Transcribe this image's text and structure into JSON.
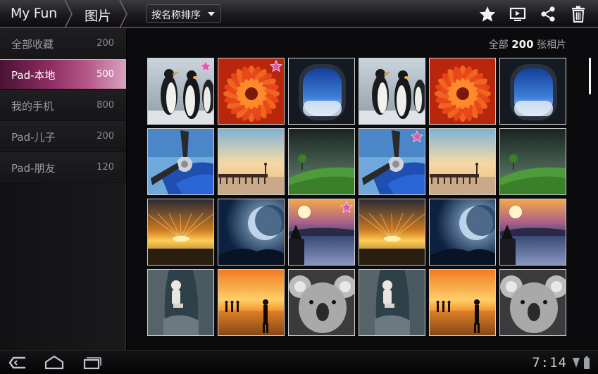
{
  "header": {
    "app_title": "My Fun",
    "page_title": "图片",
    "sort_label": "按名称排序",
    "accent_color": "#a0306a"
  },
  "toolbar": {
    "icons": [
      "star-icon",
      "slideshow-icon",
      "share-icon",
      "trash-icon"
    ]
  },
  "sidebar": {
    "items": [
      {
        "label": "全部收藏",
        "count": "200",
        "active": false
      },
      {
        "label": "Pad-本地",
        "count": "500",
        "active": true
      },
      {
        "label": "我的手机",
        "count": "800",
        "active": false
      },
      {
        "label": "Pad-儿子",
        "count": "200",
        "active": false
      },
      {
        "label": "Pad-朋友",
        "count": "120",
        "active": false
      }
    ]
  },
  "main": {
    "total_prefix": "全部",
    "total_count": "200",
    "total_suffix": "张相片",
    "photos": [
      {
        "subject": "penguins",
        "starred": true
      },
      {
        "subject": "red-flower",
        "starred": true
      },
      {
        "subject": "airplane-window",
        "starred": false
      },
      {
        "subject": "penguins",
        "starred": false
      },
      {
        "subject": "red-flower",
        "starred": false
      },
      {
        "subject": "airplane-window",
        "starred": false
      },
      {
        "subject": "propeller",
        "starred": false
      },
      {
        "subject": "pier-sunset",
        "starred": false
      },
      {
        "subject": "green-hill",
        "starred": false
      },
      {
        "subject": "propeller",
        "starred": true
      },
      {
        "subject": "pier-sunset",
        "starred": false
      },
      {
        "subject": "green-hill",
        "starred": false
      },
      {
        "subject": "sunset-sea",
        "starred": false
      },
      {
        "subject": "moon-night",
        "starred": false
      },
      {
        "subject": "sunrise-lake",
        "starred": true
      },
      {
        "subject": "sunset-sea",
        "starred": false
      },
      {
        "subject": "moon-night",
        "starred": false
      },
      {
        "subject": "sunrise-lake",
        "starred": false
      },
      {
        "subject": "girl-tree",
        "starred": false
      },
      {
        "subject": "beach-silhouettes",
        "starred": false
      },
      {
        "subject": "koala",
        "starred": false
      },
      {
        "subject": "girl-tree",
        "starred": false
      },
      {
        "subject": "beach-silhouettes",
        "starred": false
      },
      {
        "subject": "koala",
        "starred": false
      }
    ]
  },
  "system_bar": {
    "time": "7:14",
    "icons": [
      "back-icon",
      "home-icon",
      "recent-apps-icon",
      "wifi-icon",
      "battery-icon"
    ]
  }
}
